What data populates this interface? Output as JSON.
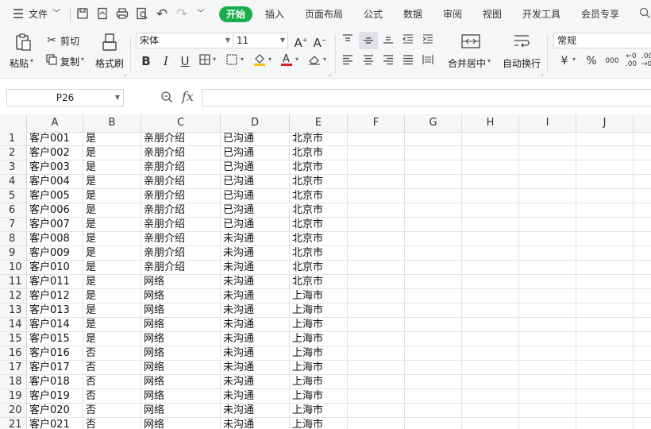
{
  "menubar": {
    "file_label": "文件",
    "tabs": [
      "开始",
      "插入",
      "页面布局",
      "公式",
      "数据",
      "审阅",
      "视图",
      "开发工具",
      "会员专享"
    ]
  },
  "ribbon": {
    "paste_label": "粘贴",
    "cut_label": "剪切",
    "copy_label": "复制",
    "format_painter_label": "格式刷",
    "font_name": "宋体",
    "font_size": "11",
    "merge_label": "合并居中",
    "wrap_label": "自动换行",
    "number_format": "常规"
  },
  "formula_bar": {
    "cell_ref": "P26",
    "fx_label": "fx",
    "formula": ""
  },
  "colors": {
    "accent": "#1aad4e",
    "font_color_bar": "#e02020",
    "fill_color_bar": "#f5c518"
  },
  "sheet": {
    "columns": [
      "A",
      "B",
      "C",
      "D",
      "E",
      "F",
      "G",
      "H",
      "I",
      "J"
    ],
    "rows": [
      {
        "n": "1",
        "a": "客户001",
        "b": "是",
        "c": "亲朋介绍",
        "d": "已沟通",
        "e": "北京市"
      },
      {
        "n": "2",
        "a": "客户002",
        "b": "是",
        "c": "亲朋介绍",
        "d": "已沟通",
        "e": "北京市"
      },
      {
        "n": "3",
        "a": "客户003",
        "b": "是",
        "c": "亲朋介绍",
        "d": "已沟通",
        "e": "北京市"
      },
      {
        "n": "4",
        "a": "客户004",
        "b": "是",
        "c": "亲朋介绍",
        "d": "已沟通",
        "e": "北京市"
      },
      {
        "n": "5",
        "a": "客户005",
        "b": "是",
        "c": "亲朋介绍",
        "d": "已沟通",
        "e": "北京市"
      },
      {
        "n": "6",
        "a": "客户006",
        "b": "是",
        "c": "亲朋介绍",
        "d": "已沟通",
        "e": "北京市"
      },
      {
        "n": "7",
        "a": "客户007",
        "b": "是",
        "c": "亲朋介绍",
        "d": "已沟通",
        "e": "北京市"
      },
      {
        "n": "8",
        "a": "客户008",
        "b": "是",
        "c": "亲朋介绍",
        "d": "未沟通",
        "e": "北京市"
      },
      {
        "n": "9",
        "a": "客户009",
        "b": "是",
        "c": "亲朋介绍",
        "d": "未沟通",
        "e": "北京市"
      },
      {
        "n": "10",
        "a": "客户010",
        "b": "是",
        "c": "亲朋介绍",
        "d": "未沟通",
        "e": "北京市"
      },
      {
        "n": "11",
        "a": "客户011",
        "b": "是",
        "c": "网络",
        "d": "未沟通",
        "e": "北京市"
      },
      {
        "n": "12",
        "a": "客户012",
        "b": "是",
        "c": "网络",
        "d": "未沟通",
        "e": "上海市"
      },
      {
        "n": "13",
        "a": "客户013",
        "b": "是",
        "c": "网络",
        "d": "未沟通",
        "e": "上海市"
      },
      {
        "n": "14",
        "a": "客户014",
        "b": "是",
        "c": "网络",
        "d": "未沟通",
        "e": "上海市"
      },
      {
        "n": "15",
        "a": "客户015",
        "b": "是",
        "c": "网络",
        "d": "未沟通",
        "e": "上海市"
      },
      {
        "n": "16",
        "a": "客户016",
        "b": "否",
        "c": "网络",
        "d": "未沟通",
        "e": "上海市"
      },
      {
        "n": "17",
        "a": "客户017",
        "b": "否",
        "c": "网络",
        "d": "未沟通",
        "e": "上海市"
      },
      {
        "n": "18",
        "a": "客户018",
        "b": "否",
        "c": "网络",
        "d": "未沟通",
        "e": "上海市"
      },
      {
        "n": "19",
        "a": "客户019",
        "b": "否",
        "c": "网络",
        "d": "未沟通",
        "e": "上海市"
      },
      {
        "n": "20",
        "a": "客户020",
        "b": "否",
        "c": "网络",
        "d": "未沟通",
        "e": "上海市"
      },
      {
        "n": "21",
        "a": "客户021",
        "b": "否",
        "c": "网络",
        "d": "未沟通",
        "e": "上海市"
      }
    ]
  }
}
